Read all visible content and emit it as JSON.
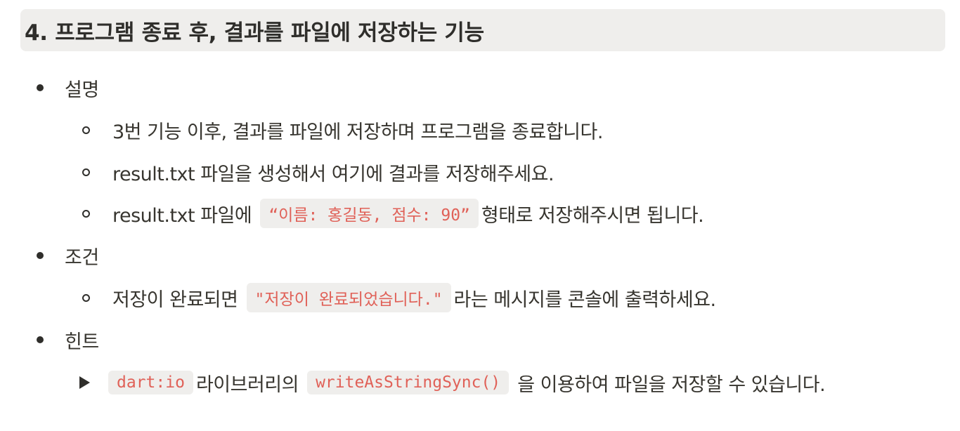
{
  "heading": "4.  프로그램 종료 후, 결과를 파일에 저장하는 기능",
  "sections": {
    "desc": {
      "label": "설명",
      "items": [
        "3번 기능 이후, 결과를 파일에 저장하며 프로그램을 종료합니다.",
        "result.txt 파일을 생성해서 여기에 결과를 저장해주세요."
      ],
      "item3": {
        "before": "result.txt 파일에 ",
        "code": "“이름: 홍길동, 점수: 90”",
        "after": "형태로 저장해주시면 됩니다."
      }
    },
    "condition": {
      "label": "조건",
      "item": {
        "before": "저장이 완료되면 ",
        "code": "\"저장이 완료되었습니다.\"",
        "after": "라는 메시지를 콘솔에 출력하세요."
      }
    },
    "hint": {
      "label": "힌트",
      "toggle": {
        "code1": "dart:io",
        "middle": "라이브러리의 ",
        "code2": "writeAsStringSync()",
        "after": " 을 이용하여 파일을 저장할 수 있습니다."
      }
    }
  },
  "colors": {
    "code_text": "#e06158",
    "code_bg": "#efeeec",
    "heading_bg": "#efeeec",
    "text": "#37352f"
  }
}
